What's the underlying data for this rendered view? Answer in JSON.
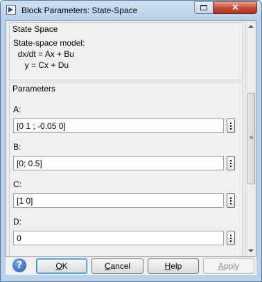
{
  "window": {
    "title": "Block Parameters: State-Space"
  },
  "block": {
    "group_title": "State Space",
    "description": [
      "State-space model:",
      "  dx/dt = Ax + Bu",
      "     y = Cx + Du"
    ]
  },
  "parameters": {
    "group_title": "Parameters",
    "fields": [
      {
        "label": "A:",
        "value": "[0 1 ; -0.05 0]"
      },
      {
        "label": "B:",
        "value": "[0; 0.5]"
      },
      {
        "label": "C:",
        "value": "[1 0]"
      },
      {
        "label": "D:",
        "value": "0"
      }
    ]
  },
  "buttons": {
    "ok": {
      "prefix": "",
      "key": "O",
      "rest": "K"
    },
    "cancel": {
      "prefix": "",
      "key": "C",
      "rest": "ancel"
    },
    "help": {
      "prefix": "",
      "key": "H",
      "rest": "elp"
    },
    "apply": {
      "prefix": "",
      "key": "A",
      "rest": "pply"
    }
  },
  "icons": {
    "app": "simulink-block-icon",
    "minimize": "restore-window-icon",
    "close": "close-icon",
    "help": "help-icon",
    "more": "more-options-icon"
  }
}
